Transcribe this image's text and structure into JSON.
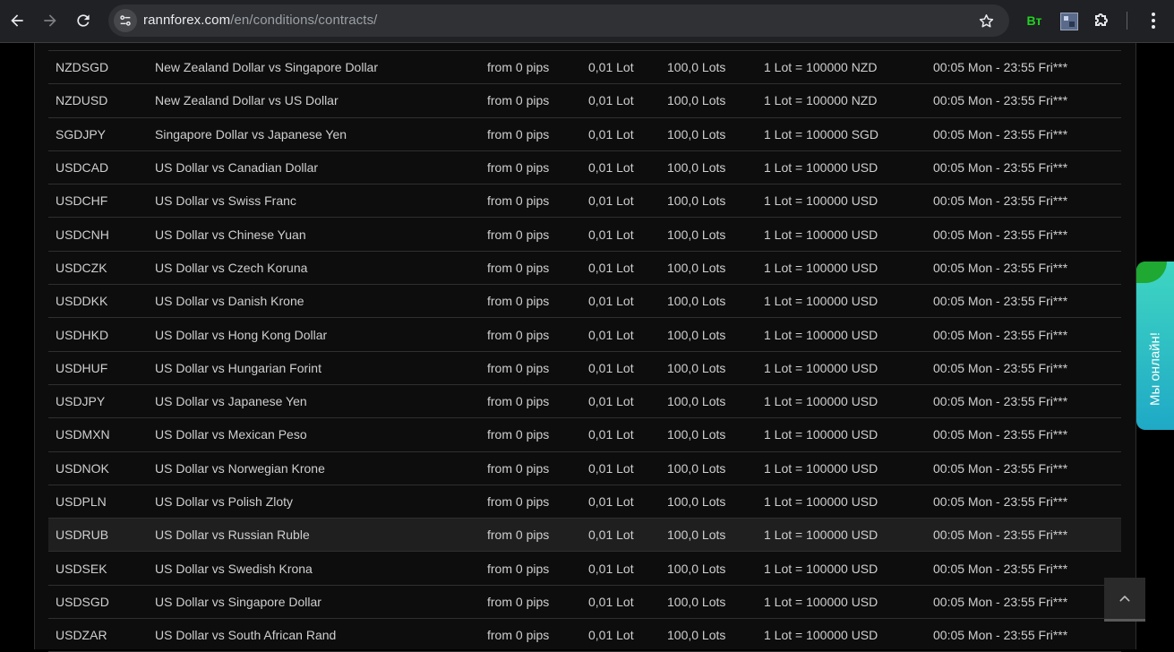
{
  "browser": {
    "url_host": "rannforex.com",
    "url_path": "/en/conditions/contracts/",
    "extension_label": "Bт"
  },
  "contracts": [
    {
      "symbol": "NZDSGD",
      "name": "New Zealand Dollar vs Singapore Dollar",
      "spread": "from 0 pips",
      "min_lot": "0,01 Lot",
      "max_lot": "100,0 Lots",
      "lot_size": "1 Lot = 100000 NZD",
      "hours": "00:05 Mon - 23:55 Fri***"
    },
    {
      "symbol": "NZDUSD",
      "name": "New Zealand Dollar vs US Dollar",
      "spread": "from 0 pips",
      "min_lot": "0,01 Lot",
      "max_lot": "100,0 Lots",
      "lot_size": "1 Lot = 100000 NZD",
      "hours": "00:05 Mon - 23:55 Fri***"
    },
    {
      "symbol": "SGDJPY",
      "name": "Singapore Dollar vs Japanese Yen",
      "spread": "from 0 pips",
      "min_lot": "0,01 Lot",
      "max_lot": "100,0 Lots",
      "lot_size": "1 Lot = 100000 SGD",
      "hours": "00:05 Mon - 23:55 Fri***"
    },
    {
      "symbol": "USDCAD",
      "name": "US Dollar vs Canadian Dollar",
      "spread": "from 0 pips",
      "min_lot": "0,01 Lot",
      "max_lot": "100,0 Lots",
      "lot_size": "1 Lot = 100000 USD",
      "hours": "00:05 Mon - 23:55 Fri***"
    },
    {
      "symbol": "USDCHF",
      "name": "US Dollar vs Swiss Franc",
      "spread": "from 0 pips",
      "min_lot": "0,01 Lot",
      "max_lot": "100,0 Lots",
      "lot_size": "1 Lot = 100000 USD",
      "hours": "00:05 Mon - 23:55 Fri***"
    },
    {
      "symbol": "USDCNH",
      "name": "US Dollar vs Chinese Yuan",
      "spread": "from 0 pips",
      "min_lot": "0,01 Lot",
      "max_lot": "100,0 Lots",
      "lot_size": "1 Lot = 100000 USD",
      "hours": "00:05 Mon - 23:55 Fri***"
    },
    {
      "symbol": "USDCZK",
      "name": "US Dollar vs Czech Koruna",
      "spread": "from 0 pips",
      "min_lot": "0,01 Lot",
      "max_lot": "100,0 Lots",
      "lot_size": "1 Lot = 100000 USD",
      "hours": "00:05 Mon - 23:55 Fri***"
    },
    {
      "symbol": "USDDKK",
      "name": "US Dollar vs Danish Krone",
      "spread": "from 0 pips",
      "min_lot": "0,01 Lot",
      "max_lot": "100,0 Lots",
      "lot_size": "1 Lot = 100000 USD",
      "hours": "00:05 Mon - 23:55 Fri***"
    },
    {
      "symbol": "USDHKD",
      "name": "US Dollar vs Hong Kong Dollar",
      "spread": "from 0 pips",
      "min_lot": "0,01 Lot",
      "max_lot": "100,0 Lots",
      "lot_size": "1 Lot = 100000 USD",
      "hours": "00:05 Mon - 23:55 Fri***"
    },
    {
      "symbol": "USDHUF",
      "name": "US Dollar vs Hungarian Forint",
      "spread": "from 0 pips",
      "min_lot": "0,01 Lot",
      "max_lot": "100,0 Lots",
      "lot_size": "1 Lot = 100000 USD",
      "hours": "00:05 Mon - 23:55 Fri***"
    },
    {
      "symbol": "USDJPY",
      "name": "US Dollar vs Japanese Yen",
      "spread": "from 0 pips",
      "min_lot": "0,01 Lot",
      "max_lot": "100,0 Lots",
      "lot_size": "1 Lot = 100000 USD",
      "hours": "00:05 Mon - 23:55 Fri***"
    },
    {
      "symbol": "USDMXN",
      "name": "US Dollar vs Mexican Peso",
      "spread": "from 0 pips",
      "min_lot": "0,01 Lot",
      "max_lot": "100,0 Lots",
      "lot_size": "1 Lot = 100000 USD",
      "hours": "00:05 Mon - 23:55 Fri***"
    },
    {
      "symbol": "USDNOK",
      "name": "US Dollar vs Norwegian Krone",
      "spread": "from 0 pips",
      "min_lot": "0,01 Lot",
      "max_lot": "100,0 Lots",
      "lot_size": "1 Lot = 100000 USD",
      "hours": "00:05 Mon - 23:55 Fri***"
    },
    {
      "symbol": "USDPLN",
      "name": "US Dollar vs Polish Zloty",
      "spread": "from 0 pips",
      "min_lot": "0,01 Lot",
      "max_lot": "100,0 Lots",
      "lot_size": "1 Lot = 100000 USD",
      "hours": "00:05 Mon - 23:55 Fri***"
    },
    {
      "symbol": "USDRUB",
      "name": "US Dollar vs Russian Ruble",
      "spread": "from 0 pips",
      "min_lot": "0,01 Lot",
      "max_lot": "100,0 Lots",
      "lot_size": "1 Lot = 100000 USD",
      "hours": "00:05 Mon - 23:55 Fri***",
      "highlighted": true
    },
    {
      "symbol": "USDSEK",
      "name": "US Dollar vs Swedish Krona",
      "spread": "from 0 pips",
      "min_lot": "0,01 Lot",
      "max_lot": "100,0 Lots",
      "lot_size": "1 Lot = 100000 USD",
      "hours": "00:05 Mon - 23:55 Fri***"
    },
    {
      "symbol": "USDSGD",
      "name": "US Dollar vs Singapore Dollar",
      "spread": "from 0 pips",
      "min_lot": "0,01 Lot",
      "max_lot": "100,0 Lots",
      "lot_size": "1 Lot = 100000 USD",
      "hours": "00:05 Mon - 23:55 Fri***"
    },
    {
      "symbol": "USDZAR",
      "name": "US Dollar vs South African Rand",
      "spread": "from 0 pips",
      "min_lot": "0,01 Lot",
      "max_lot": "100,0 Lots",
      "lot_size": "1 Lot = 100000 USD",
      "hours": "00:05 Mon - 23:55 Fri***"
    }
  ],
  "chat_widget": {
    "label": "Мы онлайн!"
  },
  "colors": {
    "page_bg": "#000000",
    "table_bg": "#0d0d0d",
    "text": "#cfcfcf",
    "row_highlight": "#1f1f1f",
    "chat_gradient_top": "#3fd6c2",
    "chat_gradient_bottom": "#1fa9c6",
    "extension_green": "#22d122"
  },
  "icons": [
    "back-arrow-icon",
    "forward-arrow-icon",
    "reload-icon",
    "site-settings-icon",
    "star-icon",
    "extension-image-icon",
    "puzzle-icon",
    "kebab-menu-icon",
    "chevron-up-icon"
  ]
}
